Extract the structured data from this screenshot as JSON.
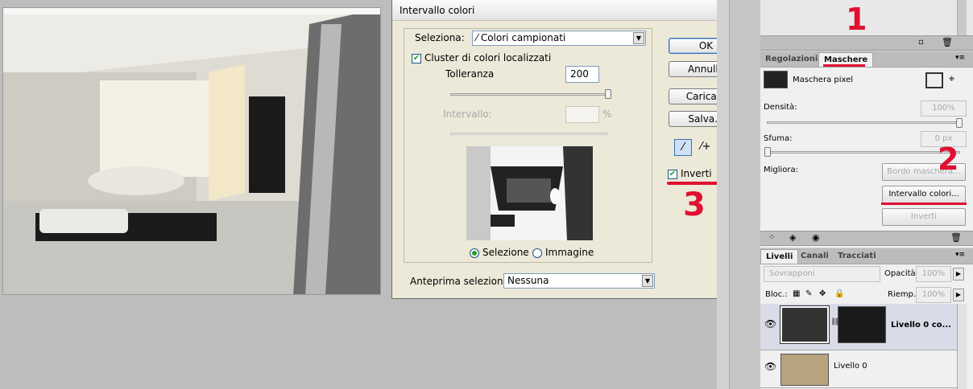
{
  "dialog": {
    "title": "Intervallo colori",
    "close": "✕",
    "select_label": "Seleziona:",
    "select_value": "Colori campionati",
    "cluster_label": "Cluster di colori localizzati",
    "tolerance_label": "Tolleranza",
    "tolerance_value": "200",
    "range_label": "Intervallo:",
    "range_unit": "%",
    "invert_label": "Inverti",
    "radio_selection": "Selezione",
    "radio_image": "Immagine",
    "preview_label": "Anteprima selezione:",
    "preview_value": "Nessuna",
    "buttons": {
      "ok": "OK",
      "cancel": "Annulla",
      "load": "Carica...",
      "save": "Salva..."
    }
  },
  "annotations": {
    "one": "1",
    "two": "2",
    "three": "3"
  },
  "masks_panel": {
    "tabs": [
      "Regolazioni",
      "Maschere"
    ],
    "mask_label": "Maschera pixel",
    "density_label": "Densità:",
    "density_value": "100%",
    "feather_label": "Sfuma:",
    "feather_value": "0 px",
    "refine_label": "Migliora:",
    "edge_button": "Bordo maschera...",
    "color_range_button": "Intervallo colori...",
    "invert_button": "Inverti"
  },
  "layers_panel": {
    "tabs": [
      "Livelli",
      "Canali",
      "Tracciati"
    ],
    "blend_mode": "Sovrapponi",
    "opacity_label": "Opacità:",
    "opacity_value": "100%",
    "lock_label": "Bloc.:",
    "fill_label": "Riemp.:",
    "fill_value": "100%",
    "layers": [
      {
        "name": "Livello 0 co..."
      },
      {
        "name": "Livello 0"
      }
    ]
  },
  "colors": {
    "annotation": "#e01030",
    "panel": "#d6d6d6",
    "selected_layer": "#d9dce8"
  }
}
